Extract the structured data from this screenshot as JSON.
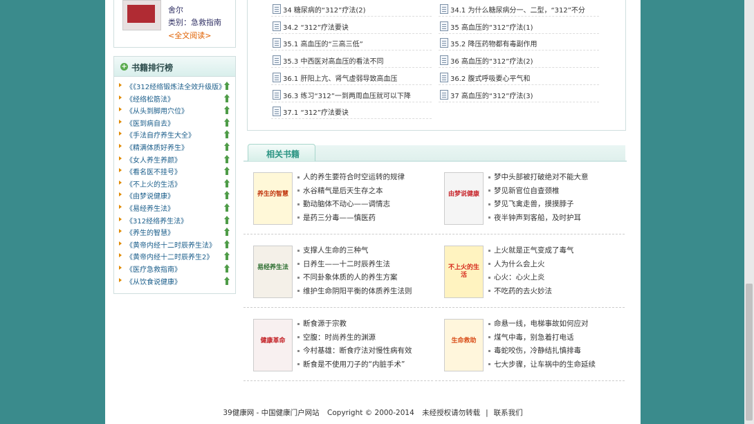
{
  "book_card": {
    "author": "舍尔",
    "category": "类别：急救指南",
    "read_all": "<全文阅读>"
  },
  "ranking": {
    "title": "书籍排行榜",
    "items": [
      "《《312经络锻炼法全效升级版》",
      "《经络松筋法》",
      "《从头到脚用穴位》",
      "《医到病自去》",
      "《手法自疗养生大全》",
      "《精满体质好养生》",
      "《女人养生养颜》",
      "《看名医不挂号》",
      "《不上火的生活》",
      "《由梦说健康》",
      "《易经养生法》",
      "《312经络养生法》",
      "《养生的智慧》",
      "《黄帝内经十二时辰养生法》",
      "《黄帝内经十二时辰养生2》",
      "《医疗急救指南》",
      "《从饮食说健康》"
    ]
  },
  "chapters": [
    "34 糖尿病的“312”疗法(2)",
    "34.1 为什么糖尿病分一、二型，“312”不分",
    "34.2 “312”疗法要诀",
    "35 高血压的“312”疗法(1)",
    "35.1 高血压的“三高三低”",
    "35.2 降压药物都有毒副作用",
    "35.3 中西医对高血压的看法不同",
    "36 高血压的“312”疗法(2)",
    "36.1 肝阳上亢、肾气虚弱导致高血压",
    "36.2 腹式呼吸要心平气和",
    "36.3 练习“312”一到两周血压就可以下降",
    "37 高血压的“312”疗法(3)",
    "37.1 “312”疗法要诀"
  ],
  "related": {
    "title": "相关书籍",
    "books": [
      {
        "cover_text": "养生的智慧",
        "lines": [
          "人的养生要符合时空运转的规律",
          "水谷精气是后天生存之本",
          "勤动脑体不动心——调情志",
          "是药三分毒——慎医药"
        ]
      },
      {
        "cover_text": "由梦说健康",
        "lines": [
          "梦中头部被打破绝对不能大意",
          "梦见新官位自查颈椎",
          "梦见飞禽走兽，摸摸脖子",
          "夜半钟声到客船，及时护耳"
        ]
      },
      {
        "cover_text": "易经养生法",
        "lines": [
          "支撑人生命的三种气",
          "日养生——十二时辰养生法",
          "不同卦象体质的人的养生方案",
          "维护生命阴阳平衡的体质养生法则"
        ]
      },
      {
        "cover_text": "不上火的生活",
        "lines": [
          "上火就是正气变成了毒气",
          "人为什么会上火",
          "心火：心火上炎",
          "不吃药的去火妙法"
        ]
      },
      {
        "cover_text": "健康革命",
        "lines": [
          "断食源于宗教",
          "空腹：时尚养生的渊源",
          "今村基雄：断食疗法对慢性病有效",
          "断食是不使用刀子的“内脏手术”"
        ]
      },
      {
        "cover_text": "生命救助",
        "lines": [
          "命悬一线，电梯事故如何应对",
          "煤气中毒，别急着打电话",
          "毒蛇咬伤，冷静结扎慎排毒",
          "七大步骤，让车祸中的生命延续"
        ]
      }
    ]
  },
  "footer": {
    "site": "39健康网 - 中国健康门户网站",
    "copyright": "Copyright © 2000-2014",
    "notice": "未经授权请勿转载",
    "divider": "|",
    "contact": "联系我们"
  },
  "colors": {
    "background": "#3a8b8c",
    "accent_green": "#2a9482",
    "link_blue": "#1a5d8a",
    "orange": "#e06000"
  }
}
